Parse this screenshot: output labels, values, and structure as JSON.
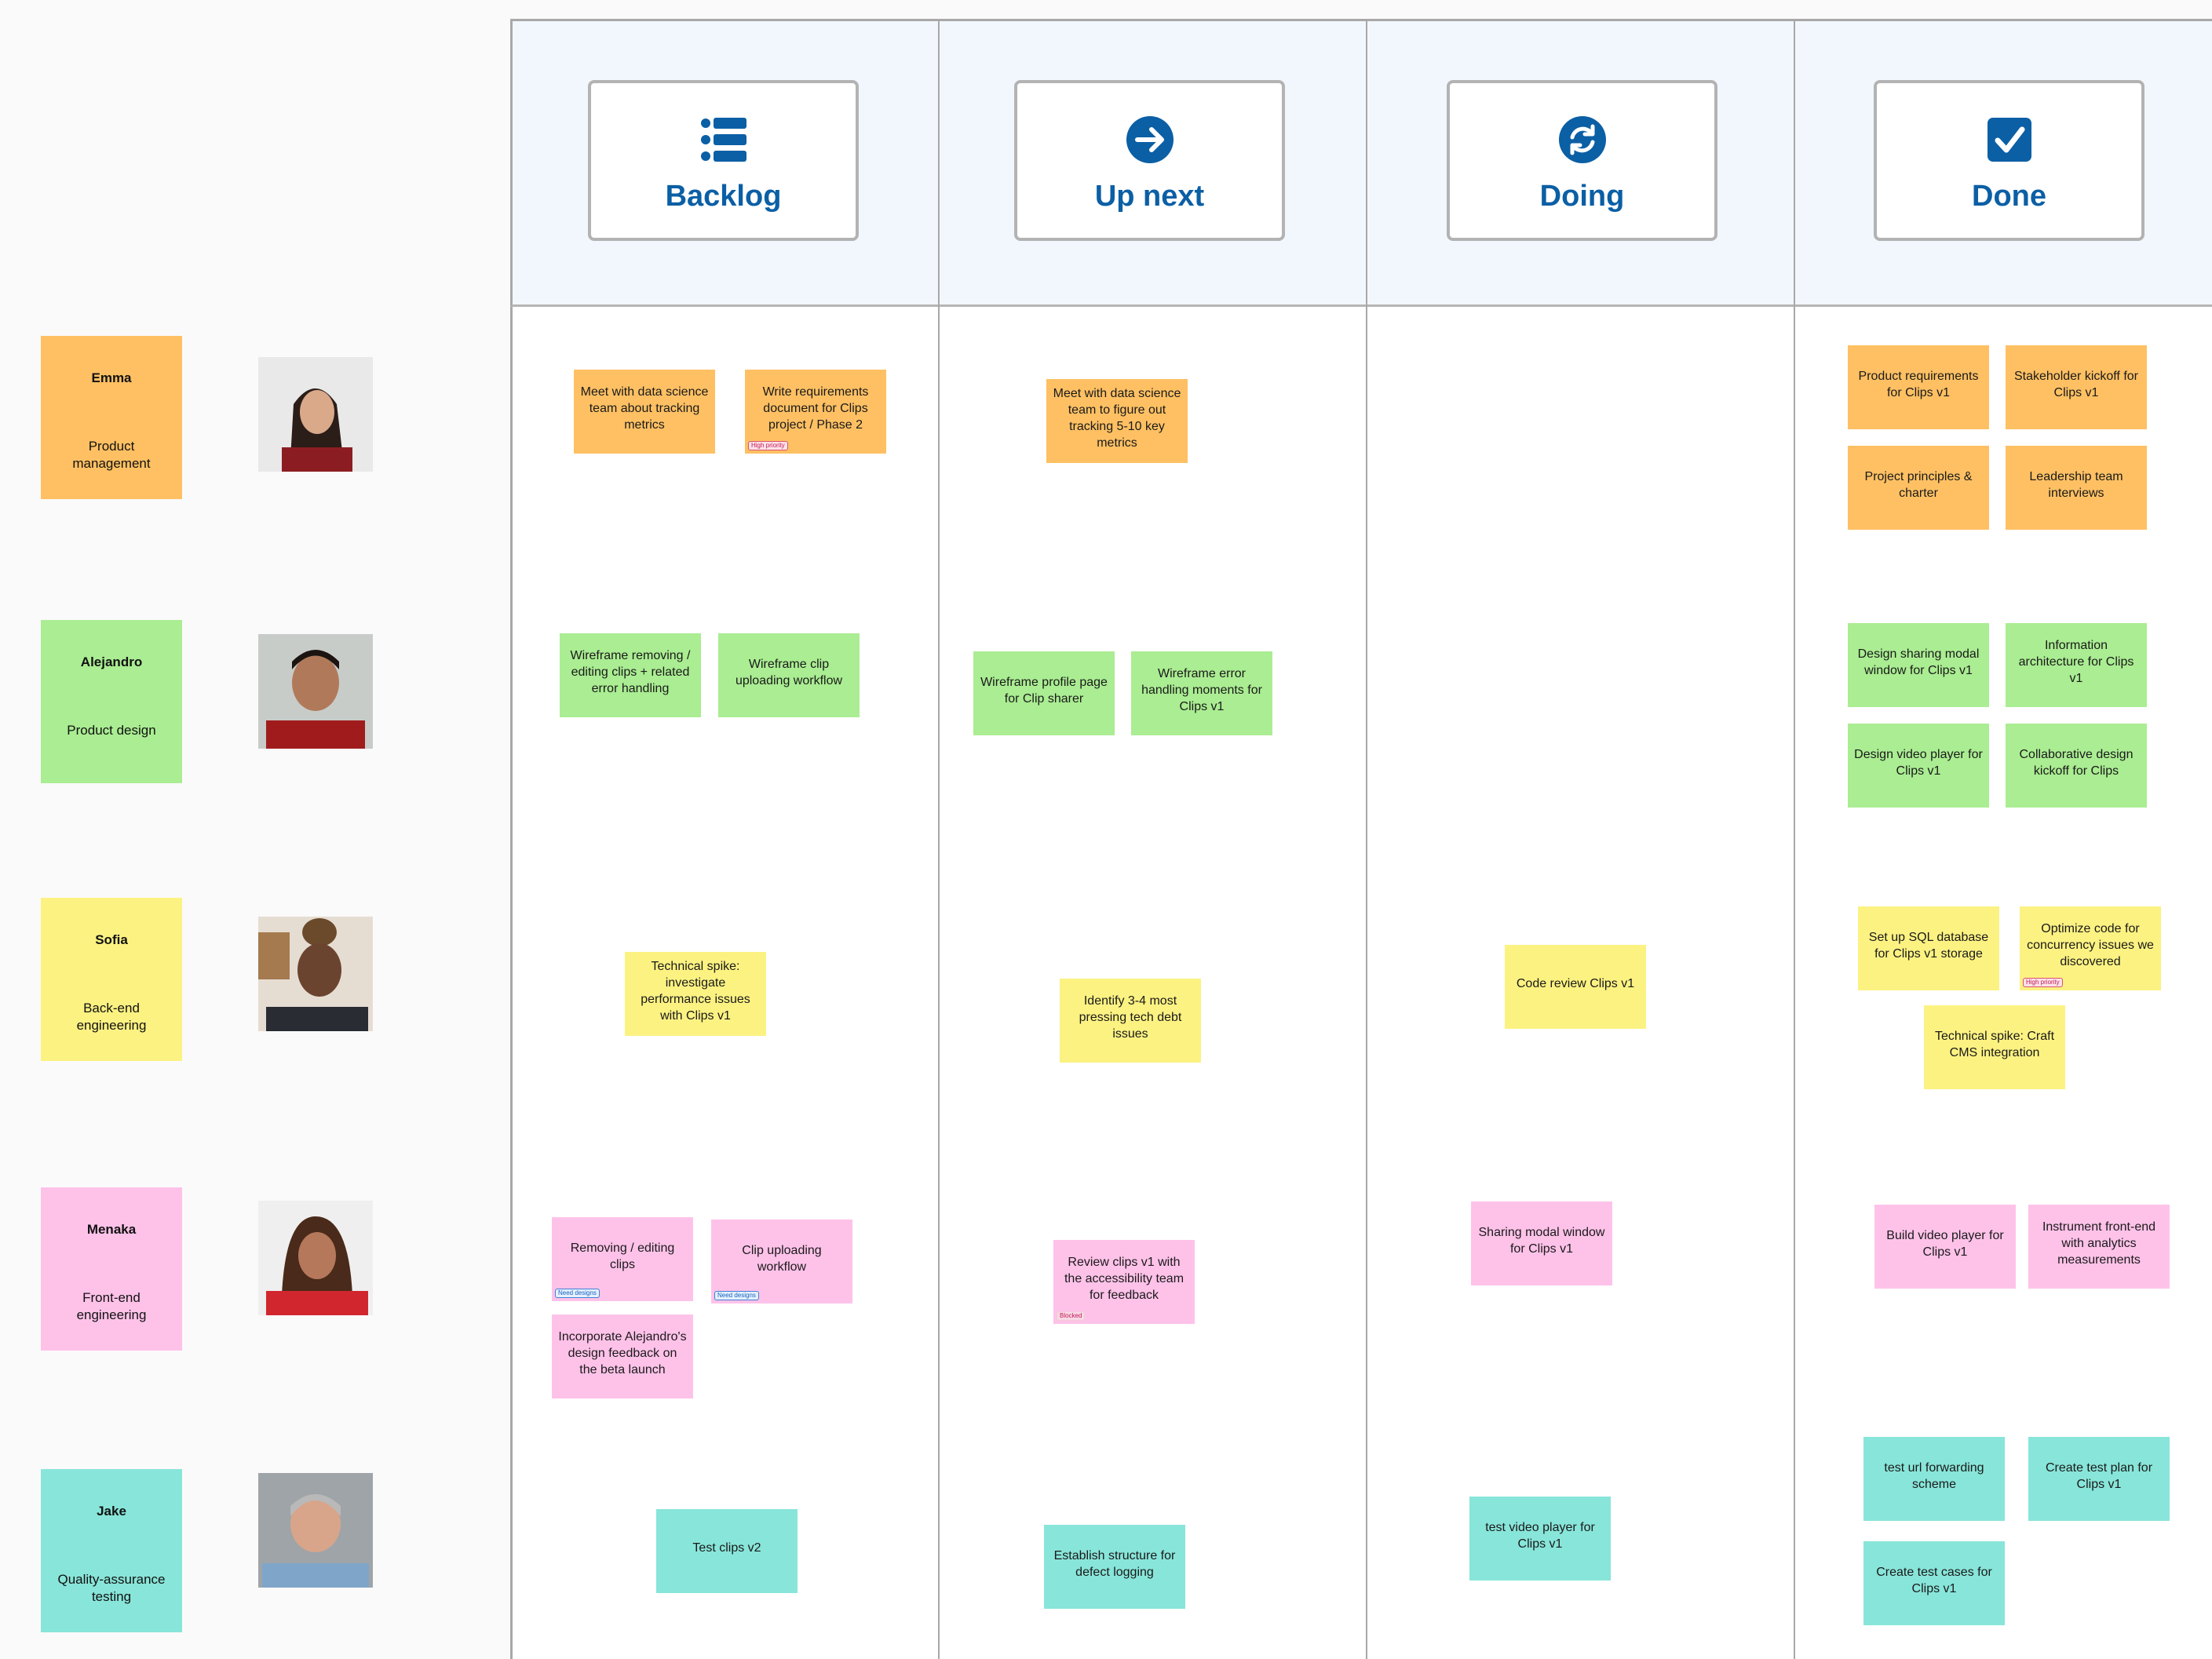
{
  "columns": [
    {
      "label": "Backlog",
      "icon": "list-icon"
    },
    {
      "label": "Up next",
      "icon": "arrow-right-circle-icon"
    },
    {
      "label": "Doing",
      "icon": "refresh-circle-icon"
    },
    {
      "label": "Done",
      "icon": "checkbox-checked-icon"
    }
  ],
  "people": [
    {
      "name": "Emma",
      "role": "Product management",
      "color": "#fec063"
    },
    {
      "name": "Alejandro",
      "role": "Product design",
      "color": "#aaed92"
    },
    {
      "name": "Sofia",
      "role": "Back-end engineering",
      "color": "#fcf282"
    },
    {
      "name": "Menaka",
      "role": "Front-end engineering",
      "color": "#fec2e9"
    },
    {
      "name": "Jake",
      "role": "Quality-assurance testing",
      "color": "#88e5d9"
    }
  ],
  "tags": {
    "high_priority": "High priority",
    "need_designs": "Need designs",
    "blocked": "Blocked"
  },
  "cards": {
    "emma": {
      "backlog": [
        "Meet with data science team about tracking metrics",
        "Write requirements document for Clips project / Phase 2"
      ],
      "up_next": [
        "Meet with data science team to figure out tracking 5-10 key metrics"
      ],
      "done": [
        "Product requirements for Clips v1",
        "Stakeholder kickoff for Clips v1",
        "Project principles & charter",
        "Leadership team interviews"
      ]
    },
    "alejandro": {
      "backlog": [
        "Wireframe removing / editing clips + related error handling",
        "Wireframe clip uploading workflow"
      ],
      "up_next": [
        "Wireframe profile page for Clip sharer",
        "Wireframe error handling moments for Clips v1"
      ],
      "done": [
        "Design sharing modal window for Clips v1",
        "Information architecture for Clips v1",
        "Design video player for Clips v1",
        "Collaborative design kickoff for Clips"
      ]
    },
    "sofia": {
      "backlog": [
        "Technical spike: investigate performance issues with Clips v1"
      ],
      "up_next": [
        "Identify 3-4 most pressing tech debt issues"
      ],
      "doing": [
        "Code review Clips v1"
      ],
      "done": [
        "Set up SQL database for Clips v1 storage",
        "Optimize code for concurrency issues we discovered",
        "Technical spike: Craft CMS integration"
      ]
    },
    "menaka": {
      "backlog": [
        "Removing / editing clips",
        "Clip uploading workflow",
        "Incorporate Alejandro's design feedback on the beta launch"
      ],
      "up_next": [
        "Review clips v1 with the accessibility team for feedback"
      ],
      "doing": [
        "Sharing modal window for Clips v1"
      ],
      "done": [
        "Build video player for Clips v1",
        "Instrument front-end with analytics measurements"
      ]
    },
    "jake": {
      "backlog": [
        "Test clips v2"
      ],
      "up_next": [
        "Establish structure for defect logging"
      ],
      "doing": [
        "test video player for Clips v1"
      ],
      "done": [
        "test url forwarding scheme",
        "Create test plan for Clips v1",
        "Create test cases for Clips v1"
      ]
    }
  }
}
